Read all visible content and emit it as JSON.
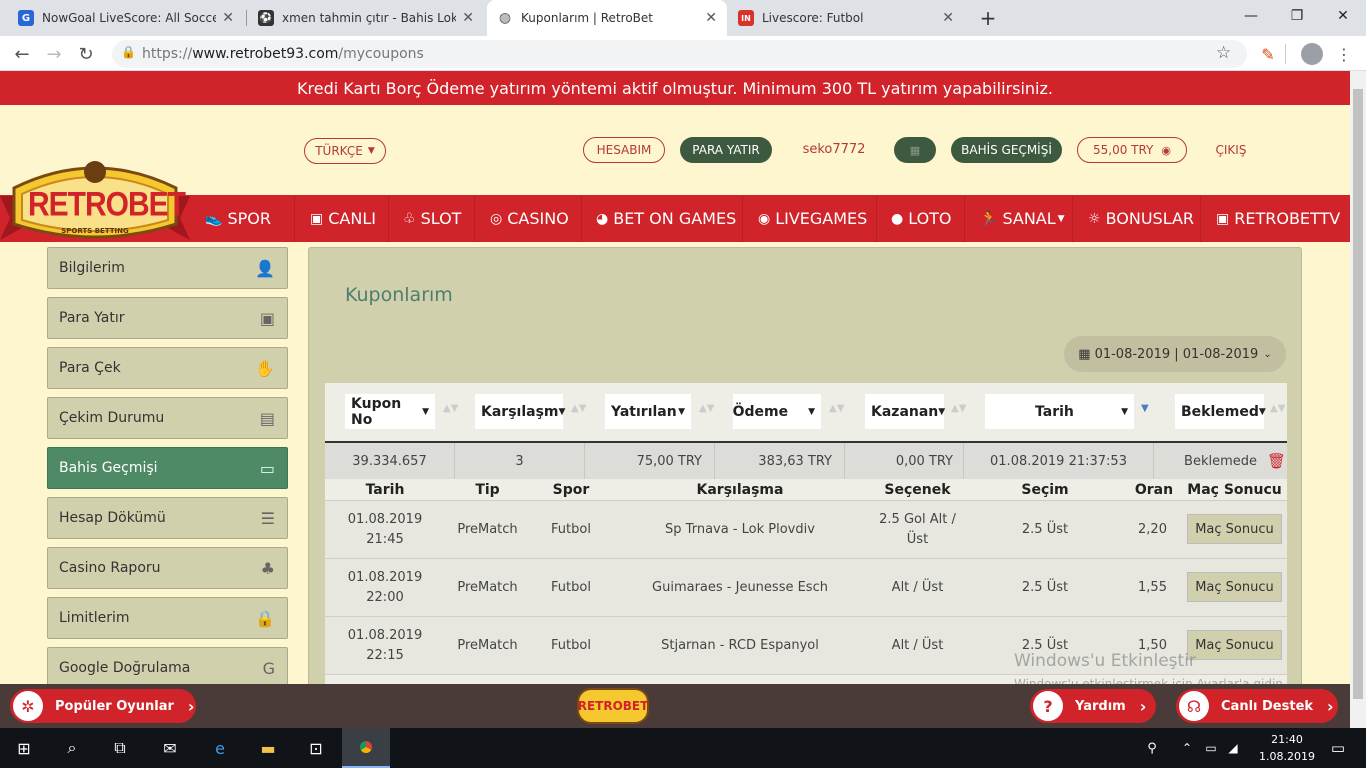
{
  "browser": {
    "tabs": [
      {
        "title": "NowGoal LiveScore: All Soccer Sc",
        "fav_color": "#2a66d8",
        "fav_char": "G"
      },
      {
        "title": "xmen tahmin çıtır - Bahis Lokal -",
        "fav_color": "#333333",
        "fav_char": "⚽"
      },
      {
        "title": "Kuponlarım | RetroBet",
        "fav_color": "#666666",
        "fav_char": "◍"
      },
      {
        "title": "Livescore: Futbol",
        "fav_color": "#d6342b",
        "fav_char": "IN"
      }
    ],
    "new_tab": "+",
    "url_prefix": "https://",
    "url_host": "www.retrobet93.com",
    "url_path": "/mycoupons"
  },
  "announcement": "Kredi Kartı Borç Ödeme yatırım yöntemi aktif olmuştur. Minimum 300 TL yatırım yapabilirsiniz.",
  "header": {
    "language": "TÜRKÇE",
    "account": "HESABIM",
    "deposit": "PARA YATIR",
    "username": "seko7772",
    "history": "BAHİS GEÇMİŞİ",
    "balance": "55,00 TRY",
    "logout": "ÇIKIŞ"
  },
  "logo": {
    "name": "RETROBET",
    "tagline": "SPORTS BETTING"
  },
  "nav": [
    {
      "label": "SPOR",
      "icon": "sneaker-icon"
    },
    {
      "label": "CANLI",
      "icon": "tv-icon"
    },
    {
      "label": "SLOT",
      "icon": "slot-icon"
    },
    {
      "label": "CASINO",
      "icon": "chip-icon"
    },
    {
      "label": "BET ON GAMES",
      "icon": "gamepad-icon"
    },
    {
      "label": "LIVEGAMES",
      "icon": "live-icon"
    },
    {
      "label": "LOTO",
      "icon": "loto-icon"
    },
    {
      "label": "SANAL",
      "icon": "runner-icon"
    },
    {
      "label": "BONUSLAR",
      "icon": "bulb-icon"
    },
    {
      "label": "RETROBETTV",
      "icon": "tv-icon"
    }
  ],
  "sidebar": [
    {
      "label": "Bilgilerim",
      "icon": "user-icon",
      "glyph": "👤"
    },
    {
      "label": "Para Yatır",
      "icon": "wallet-icon",
      "glyph": "▣"
    },
    {
      "label": "Para Çek",
      "icon": "hand-coin-icon",
      "glyph": "✋"
    },
    {
      "label": "Çekim Durumu",
      "icon": "money-icon",
      "glyph": "▤"
    },
    {
      "label": "Bahis Geçmişi",
      "icon": "ticket-icon",
      "glyph": "▭",
      "active": true
    },
    {
      "label": "Hesap Dökümü",
      "icon": "list-icon",
      "glyph": "☰"
    },
    {
      "label": "Casino Raporu",
      "icon": "cherry-icon",
      "glyph": "♣"
    },
    {
      "label": "Limitlerim",
      "icon": "lock-icon",
      "glyph": "🔒"
    },
    {
      "label": "Google Doğrulama",
      "icon": "google-icon",
      "glyph": "G"
    }
  ],
  "panel": {
    "title": "Kuponlarım",
    "date_range": "01-08-2019 | 01-08-2019",
    "filters": [
      "Kupon No",
      "Karşılaşm",
      "Yatırılan",
      "Ödeme",
      "Kazanan",
      "Tarih",
      "Beklemed"
    ],
    "summary": {
      "coupon_no": "39.334.657",
      "matches": "3",
      "stake": "75,00 TRY",
      "payout": "383,63 TRY",
      "won": "0,00 TRY",
      "date": "01.08.2019 21:37:53",
      "status": "Beklemede"
    },
    "detail_headers": [
      "Tarih",
      "Tip",
      "Spor",
      "Karşılaşma",
      "Seçenek",
      "Seçim",
      "Oran",
      "Maç Sonucu"
    ],
    "rows": [
      {
        "date": "01.08.2019",
        "time": "21:45",
        "type": "PreMatch",
        "sport": "Futbol",
        "match": "Sp Trnava - Lok Plovdiv",
        "option": "2.5 Gol Alt /",
        "option2": "Üst",
        "pick": "2.5 Üst",
        "odds": "2,20",
        "btn": "Maç Sonucu"
      },
      {
        "date": "01.08.2019",
        "time": "22:00",
        "type": "PreMatch",
        "sport": "Futbol",
        "match": "Guimaraes - Jeunesse Esch",
        "option": "Alt / Üst",
        "option2": "",
        "pick": "2.5 Üst",
        "odds": "1,55",
        "btn": "Maç Sonucu"
      },
      {
        "date": "01.08.2019",
        "time": "22:15",
        "type": "PreMatch",
        "sport": "Futbol",
        "match": "Stjarnan - RCD Espanyol",
        "option": "Alt / Üst",
        "option2": "",
        "pick": "2.5 Üst",
        "odds": "1,50",
        "btn": "Maç Sonucu"
      }
    ]
  },
  "watermark": {
    "line1": "Windows'u Etkinleştir",
    "line2": "Windows'u etkinleştirmek için Ayarlar'a gidin."
  },
  "bottom": {
    "popular": "Popüler Oyunlar",
    "help": "Yardım",
    "support": "Canlı Destek"
  },
  "taskbar": {
    "time": "21:40",
    "date": "1.08.2019"
  },
  "colors": {
    "brand_red": "#d1232a",
    "dark_green": "#3d5a40",
    "active_green": "#4e8a66",
    "cream": "#fdf6cf"
  }
}
